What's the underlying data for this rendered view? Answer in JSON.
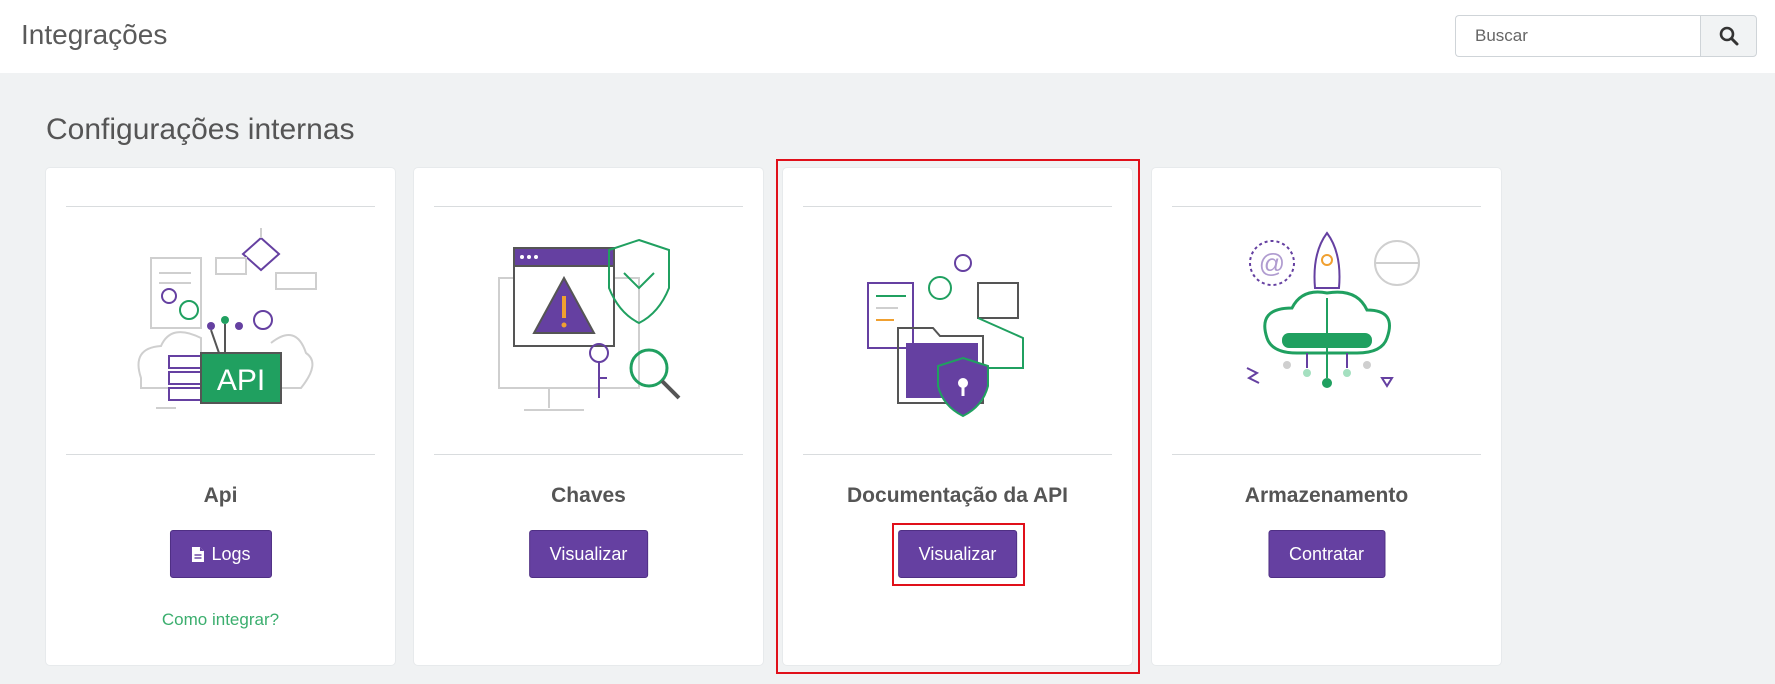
{
  "header": {
    "title": "Integrações",
    "search": {
      "placeholder": "Buscar",
      "value": ""
    }
  },
  "section": {
    "title": "Configurações internas"
  },
  "cards": [
    {
      "title": "Api",
      "button_label": "Logs",
      "link_text": "Como integrar?",
      "illustration": "api-illustration"
    },
    {
      "title": "Chaves",
      "button_label": "Visualizar",
      "illustration": "keys-illustration"
    },
    {
      "title": "Documentação da API",
      "button_label": "Visualizar",
      "illustration": "api-docs-illustration"
    },
    {
      "title": "Armazenamento",
      "button_label": "Contratar",
      "illustration": "storage-cloud-illustration"
    }
  ],
  "colors": {
    "accent": "#6540a1",
    "green": "#3bae6e",
    "highlight": "#e0101a",
    "background": "#f0f2f3"
  },
  "icons": {
    "search": "search-icon",
    "logs_button": "file-icon"
  }
}
